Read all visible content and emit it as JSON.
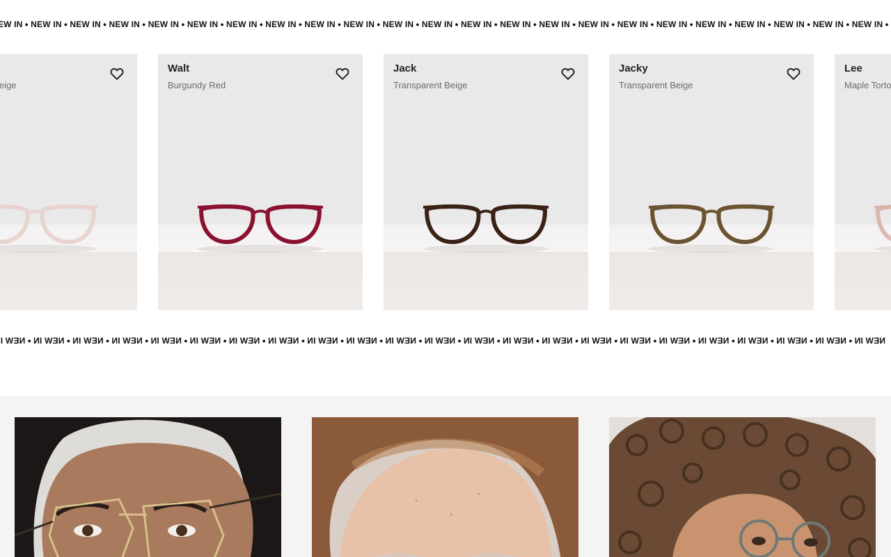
{
  "marquee": {
    "label": "NEW IN",
    "separator": "●"
  },
  "products": [
    {
      "name": "",
      "color": "Transparent Beige",
      "frame_color": "#e8d2cb",
      "frame_opacity": 0.9
    },
    {
      "name": "Walt",
      "color": "Burgundy Red",
      "frame_color": "#8a1230",
      "frame_opacity": 1
    },
    {
      "name": "Jack",
      "color": "Transparent Beige",
      "frame_color": "#3a2217",
      "frame_opacity": 1
    },
    {
      "name": "Jacky",
      "color": "Transparent Beige",
      "frame_color": "#6b5432",
      "frame_opacity": 1
    },
    {
      "name": "Lee",
      "color": "Maple Tortoise",
      "frame_color": "#d8b3a8",
      "frame_opacity": 0.9
    }
  ],
  "icons": {
    "favorite": "heart-outline-icon"
  },
  "colors": {
    "card_background": "#e9e9e9",
    "section_background": "#f4f4f4",
    "text_primary": "#222222",
    "text_secondary": "#6b6b6b"
  },
  "portraits": [
    {
      "subject": "woman-gold-frames"
    },
    {
      "subject": "woman-clear-frames"
    },
    {
      "subject": "woman-curly-hair-grey-frames"
    }
  ]
}
